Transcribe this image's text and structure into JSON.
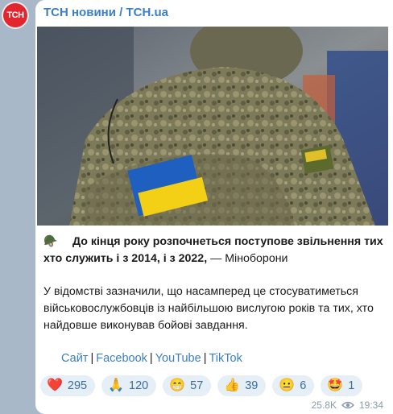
{
  "channel": {
    "avatar_text": "ТСН",
    "title": "ТСН новини / TCH.ua"
  },
  "post": {
    "emoji": "🪖",
    "headline": "До кінця року розпочнеться поступове звільнення тих хто служить і з 2014, і з 2022,",
    "source": "— Міноборони",
    "body": "У відомстві зазначили, що насамперед це стосуватиметься військовослужбовців із найбільшою вислугою років та тих, хто найдовше виконував бойові завдання."
  },
  "links": [
    {
      "label": "Сайт"
    },
    {
      "label": "Facebook"
    },
    {
      "label": "YouTube"
    },
    {
      "label": "TikTok"
    }
  ],
  "link_separator": "|",
  "reactions": [
    {
      "emoji": "❤️",
      "count": "295"
    },
    {
      "emoji": "🙏",
      "count": "120"
    },
    {
      "emoji": "😁",
      "count": "57"
    },
    {
      "emoji": "👍",
      "count": "39"
    },
    {
      "emoji": "😐",
      "count": "6"
    },
    {
      "emoji": "🤩",
      "count": "1"
    }
  ],
  "meta": {
    "views": "25.8K",
    "time": "19:34"
  }
}
